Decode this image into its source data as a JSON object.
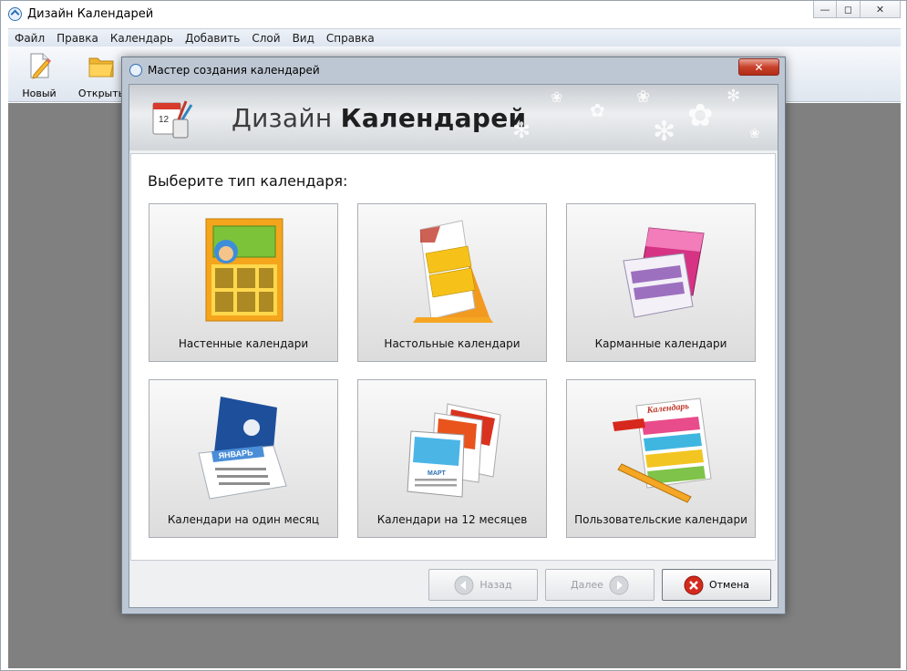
{
  "window": {
    "title": "Дизайн Календарей",
    "controls": {
      "minimize": "—",
      "maximize": "◻",
      "close": "✕"
    }
  },
  "menu": [
    "Файл",
    "Правка",
    "Календарь",
    "Добавить",
    "Слой",
    "Вид",
    "Справка"
  ],
  "toolbar": [
    {
      "label": "Новый",
      "icon": "new-document-icon"
    },
    {
      "label": "Открыть",
      "icon": "open-folder-icon"
    }
  ],
  "dialog": {
    "title": "Мастер создания календарей",
    "close": "✕",
    "banner": {
      "title_light": "Дизайн",
      "title_bold": "Календарей"
    },
    "prompt": "Выберите тип календаря:",
    "cards": [
      {
        "label": "Настенные календари",
        "icon": "wall-calendar-icon"
      },
      {
        "label": "Настольные календари",
        "icon": "desk-calendar-icon"
      },
      {
        "label": "Карманные календари",
        "icon": "pocket-calendar-icon"
      },
      {
        "label": "Календари на один месяц",
        "icon": "monthly-calendar-icon",
        "art_text": "ЯНВАРЬ"
      },
      {
        "label": "Календари на 12 месяцев",
        "icon": "twelve-month-calendar-icon",
        "art_text": "МАРТ"
      },
      {
        "label": "Пользовательские календари",
        "icon": "custom-calendar-icon",
        "art_text": "Календарь"
      }
    ],
    "buttons": {
      "back": "Назад",
      "next": "Далее",
      "cancel": "Отмена"
    },
    "banner_calendar_number": "12"
  },
  "colors": {
    "workspace": "#808080",
    "accent": "#2d6fb4",
    "cancel_icon": "#d42a1c"
  }
}
